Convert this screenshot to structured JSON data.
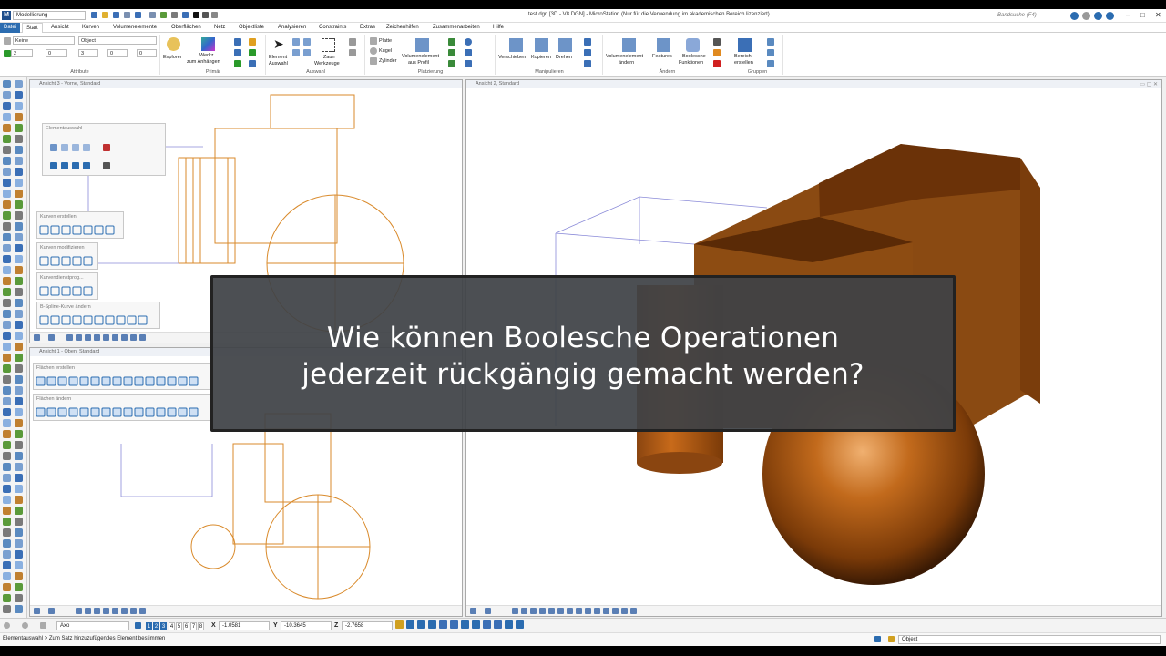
{
  "window": {
    "title": "test.dgn [3D - V8 DGN] - MicroStation (Nur für die Verwendung im akademischen Bereich lizenziert)",
    "workspace": "Modellierung",
    "search_placeholder": "Bandsuche (F4)"
  },
  "menu": {
    "tabs": [
      "Datei",
      "Start",
      "Ansicht",
      "Kurven",
      "Volumenelemente",
      "Oberflächen",
      "Netz",
      "Objektliste",
      "Analysieren",
      "Constraints",
      "Extras",
      "Zeichenhilfen",
      "Zusammenarbeiten",
      "Hilfe"
    ],
    "active": "Start"
  },
  "ribbon": {
    "attribute": {
      "label": "Attribute",
      "level": "Keine",
      "style": "Object",
      "color": "2",
      "weight": "0",
      "linestyle": "3",
      "transparency": "0",
      "priority": "0"
    },
    "primaer": {
      "label": "Primär",
      "explorer": "Explorer",
      "werkzeug_line1": "Werkz.",
      "werkzeug_line2": "zum Anhängen"
    },
    "auswahl": {
      "label": "Auswahl",
      "element_line1": "Element",
      "element_line2": "Auswahl",
      "zaun_line1": "Zaun",
      "zaun_line2": "Werkzeuge"
    },
    "platzierung": {
      "label": "Platzierung",
      "platte": "Platte",
      "kugel": "Kugel",
      "zylinder": "Zylinder",
      "vol_line1": "Volumenelement",
      "vol_line2": "aus Profil"
    },
    "manipulieren": {
      "label": "Manipulieren",
      "verschieben": "Verschieben",
      "kopieren": "Kopieren",
      "drehen": "Drehen"
    },
    "aendern": {
      "label": "Ändern",
      "vol_line1": "Volumenelement",
      "vol_line2": "ändern",
      "features": "Features",
      "bool_line1": "Boolesche",
      "bool_line2": "Funktionen"
    },
    "gruppen": {
      "label": "Gruppen",
      "bereich_line1": "Bereich",
      "bereich_line2": "erstellen"
    }
  },
  "views": {
    "view3_title": "Ansicht 3 - Vorne, Standard",
    "view1_title": "Ansicht 1 - Oben, Standard",
    "view2_title": "Ansicht 2, Standard"
  },
  "palettes": {
    "elementauswahl": "Elementauswahl",
    "kurven_erstellen": "Kurven erstellen",
    "kurven_modifizieren": "Kurven modifizieren",
    "kurvendienstprog": "Kurvendienstprog...",
    "bspline": "B-Spline-Kurve ändern",
    "flaechen_erstellen": "Flächen erstellen",
    "flaechen_aendern": "Flächen ändern"
  },
  "status": {
    "view_level": "Axo",
    "view_numbers": [
      "1",
      "2",
      "3",
      "4",
      "5",
      "6",
      "7",
      "8"
    ],
    "x_label": "X",
    "x_value": "-1.0581",
    "y_label": "Y",
    "y_value": "-10.3645",
    "z_label": "Z",
    "z_value": "-2.7658",
    "prompt": "Elementauswahl > Zum Satz hinzuzufügendes Element bestimmen",
    "right_field": "Object"
  },
  "overlay": {
    "line1": "Wie können Boolesche Operationen",
    "line2": "jederzeit rückgängig gemacht werden?"
  },
  "colors": {
    "accent": "#2b6cb0",
    "wire_orange": "#d98a2b",
    "wire_blue": "#8a8ad8",
    "solid_brown": "#8a4a12",
    "solid_dark": "#4a2408",
    "overlay_bg": "#3e4246"
  }
}
